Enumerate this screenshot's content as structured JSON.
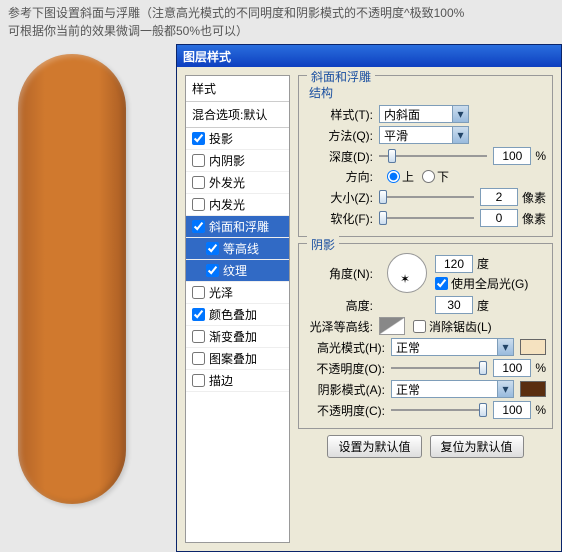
{
  "caption_line1": "参考下图设置斜面与浮雕（注意高光模式的不同明度和阴影模式的不透明度^极致100%",
  "caption_line2": "可根据你当前的效果微调一般都50%也可以）",
  "dialog": {
    "title": "图层样式",
    "styles_header": "样式",
    "blend_options": "混合选项:默认",
    "items": {
      "drop_shadow": "投影",
      "inner_shadow": "内阴影",
      "outer_glow": "外发光",
      "inner_glow": "内发光",
      "bevel": "斜面和浮雕",
      "contour": "等高线",
      "texture": "纹理",
      "satin": "光泽",
      "color_overlay": "颜色叠加",
      "gradient_overlay": "渐变叠加",
      "pattern_overlay": "图案叠加",
      "stroke": "描边"
    }
  },
  "bevel": {
    "group_title": "斜面和浮雕",
    "structure_title": "结构",
    "style_label": "样式(T):",
    "style_value": "内斜面",
    "technique_label": "方法(Q):",
    "technique_value": "平滑",
    "depth_label": "深度(D):",
    "depth_value": "100",
    "depth_unit": "%",
    "direction_label": "方向:",
    "dir_up": "上",
    "dir_down": "下",
    "size_label": "大小(Z):",
    "size_value": "2",
    "size_unit": "像素",
    "soften_label": "软化(F):",
    "soften_value": "0",
    "soften_unit": "像素"
  },
  "shading": {
    "title": "阴影",
    "angle_label": "角度(N):",
    "angle_value": "120",
    "angle_unit": "度",
    "global_light": "使用全局光(G)",
    "altitude_label": "高度:",
    "altitude_value": "30",
    "altitude_unit": "度",
    "gloss_label": "光泽等高线:",
    "antialias": "消除锯齿(L)",
    "highlight_mode_label": "高光模式(H):",
    "highlight_mode_value": "正常",
    "highlight_color": "#f5e2c0",
    "highlight_opacity_label": "不透明度(O):",
    "highlight_opacity_value": "100",
    "highlight_opacity_unit": "%",
    "shadow_mode_label": "阴影模式(A):",
    "shadow_mode_value": "正常",
    "shadow_color": "#5a2e10",
    "shadow_opacity_label": "不透明度(C):",
    "shadow_opacity_value": "100",
    "shadow_opacity_unit": "%"
  },
  "buttons": {
    "make_default": "设置为默认值",
    "reset_default": "复位为默认值"
  }
}
